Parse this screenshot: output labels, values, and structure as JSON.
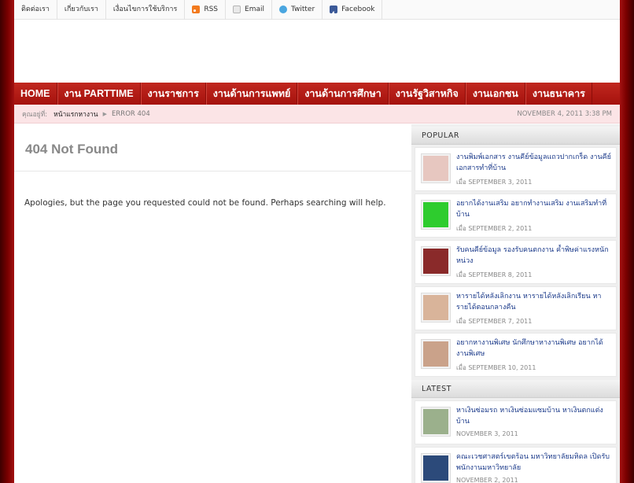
{
  "topbar": {
    "links": [
      "ติดต่อเรา",
      "เกี่ยวกับเรา",
      "เงื่อนไขการใช้บริการ"
    ],
    "rss": "RSS",
    "email": "Email",
    "twitter": "Twitter",
    "facebook": "Facebook"
  },
  "nav": {
    "items": [
      "HOME",
      "งาน PARTTIME",
      "งานราชการ",
      "งานด้านการแพทย์",
      "งานด้านการศึกษา",
      "งานรัฐวิสาหกิจ",
      "งานเอกชน",
      "งานธนาคาร"
    ]
  },
  "breadcrumb": {
    "label": "คุณอยู่ที่:",
    "home": "หน้าแรกหางาน",
    "current": "ERROR 404",
    "date": "NOVEMBER 4, 2011 3:38 PM"
  },
  "main": {
    "title": "404 Not Found",
    "message": "Apologies, but the page you requested could not be found. Perhaps searching will help."
  },
  "sidebar": {
    "popular_title": "POPULAR",
    "latest_title": "LATEST",
    "popular": [
      {
        "title": "งานพิมพ์เอกสาร งานคีย์ข้อมูลแถวปากเกร็ด งานคีย์เอกสารทำที่บ้าน",
        "date": "เมื่อ SEPTEMBER 3, 2011",
        "thumb_color": "#e7c7c0"
      },
      {
        "title": "อยากได้งานเสริม อยากทำงานเสริม งานเสริมทำที่บ้าน",
        "date": "เมื่อ SEPTEMBER 2, 2011",
        "thumb_color": "#2ecc2e"
      },
      {
        "title": "รับคนคีย์ข้อมูล รองรับคนตกงาน ค้ำพิษค่าแรงหนักหน่วง",
        "date": "เมื่อ SEPTEMBER 8, 2011",
        "thumb_color": "#8a2a2a"
      },
      {
        "title": "หารายได้หลังเลิกงาน หารายได้หลังเลิกเรียน หารายได้ตอนกลางคืน",
        "date": "เมื่อ SEPTEMBER 7, 2011",
        "thumb_color": "#d9b49a"
      },
      {
        "title": "อยากหางานพิเศษ นักศึกษาหางานพิเศษ อยากได้งานพิเศษ",
        "date": "เมื่อ SEPTEMBER 10, 2011",
        "thumb_color": "#caa28a"
      }
    ],
    "latest": [
      {
        "title": "หาเงินซ่อมรถ หาเงินซ่อมแซมบ้าน หาเงินตกแต่งบ้าน",
        "date": "NOVEMBER 3, 2011",
        "thumb_color": "#9bb08c"
      },
      {
        "title": "คณะเวชศาสตร์เขตร้อน มหาวิทยาลัยมหิดล เปิดรับพนักงานมหาวิทยาลัย",
        "date": "NOVEMBER 2, 2011",
        "thumb_color": "#2c4a7a"
      }
    ]
  }
}
